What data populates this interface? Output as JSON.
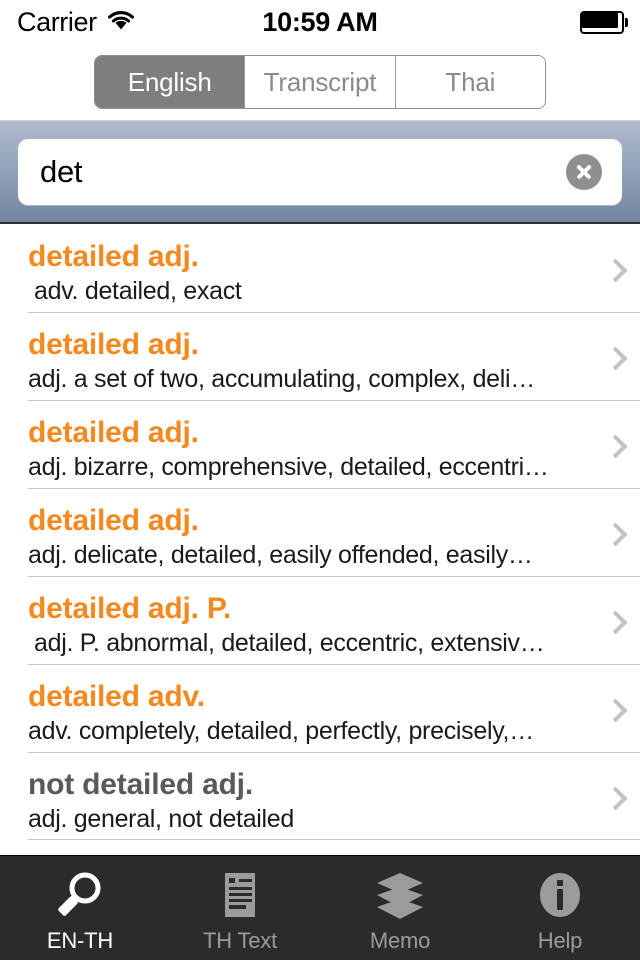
{
  "status_bar": {
    "carrier": "Carrier",
    "wifi_icon": "wifi-icon",
    "time": "10:59 AM",
    "battery_icon": "battery-full-icon"
  },
  "segmented_control": {
    "segments": [
      {
        "label": "English",
        "selected": true
      },
      {
        "label": "Transcript",
        "selected": false
      },
      {
        "label": "Thai",
        "selected": false
      }
    ]
  },
  "search": {
    "value": "det",
    "placeholder": "Search",
    "clear_icon": "clear-circle-icon"
  },
  "results": [
    {
      "title": "detailed adj.",
      "subtitle": "adv. detailed, exact",
      "muted": false,
      "indent": true
    },
    {
      "title": "detailed adj.",
      "subtitle": "adj. a set of two, accumulating, complex, deli…",
      "muted": false,
      "indent": false
    },
    {
      "title": "detailed adj.",
      "subtitle": "adj. bizarre, comprehensive, detailed, eccentri…",
      "muted": false,
      "indent": false
    },
    {
      "title": "detailed adj.",
      "subtitle": "adj. delicate, detailed, easily offended, easily…",
      "muted": false,
      "indent": false
    },
    {
      "title": "detailed adj. P.",
      "subtitle": "adj. P. abnormal, detailed, eccentric, extensiv…",
      "muted": false,
      "indent": true
    },
    {
      "title": "detailed adv.",
      "subtitle": "adv. completely, detailed, perfectly, precisely,…",
      "muted": false,
      "indent": false
    },
    {
      "title": "not detailed adj.",
      "subtitle": "adj. general, not detailed",
      "muted": true,
      "indent": false
    }
  ],
  "tab_bar": {
    "tabs": [
      {
        "label": "EN-TH",
        "icon": "magnifier-icon",
        "active": true
      },
      {
        "label": "TH Text",
        "icon": "document-icon",
        "active": false
      },
      {
        "label": "Memo",
        "icon": "layers-icon",
        "active": false
      },
      {
        "label": "Help",
        "icon": "info-circle-icon",
        "active": false
      }
    ]
  },
  "colors": {
    "accent_orange": "#f5881f",
    "muted_title": "#595959",
    "segment_selected_bg": "#7e7e7e",
    "tabbar_bg": "#2b2b2b",
    "searchbar_gradient_top": "#b0bccd",
    "searchbar_gradient_bottom": "#74839d"
  }
}
